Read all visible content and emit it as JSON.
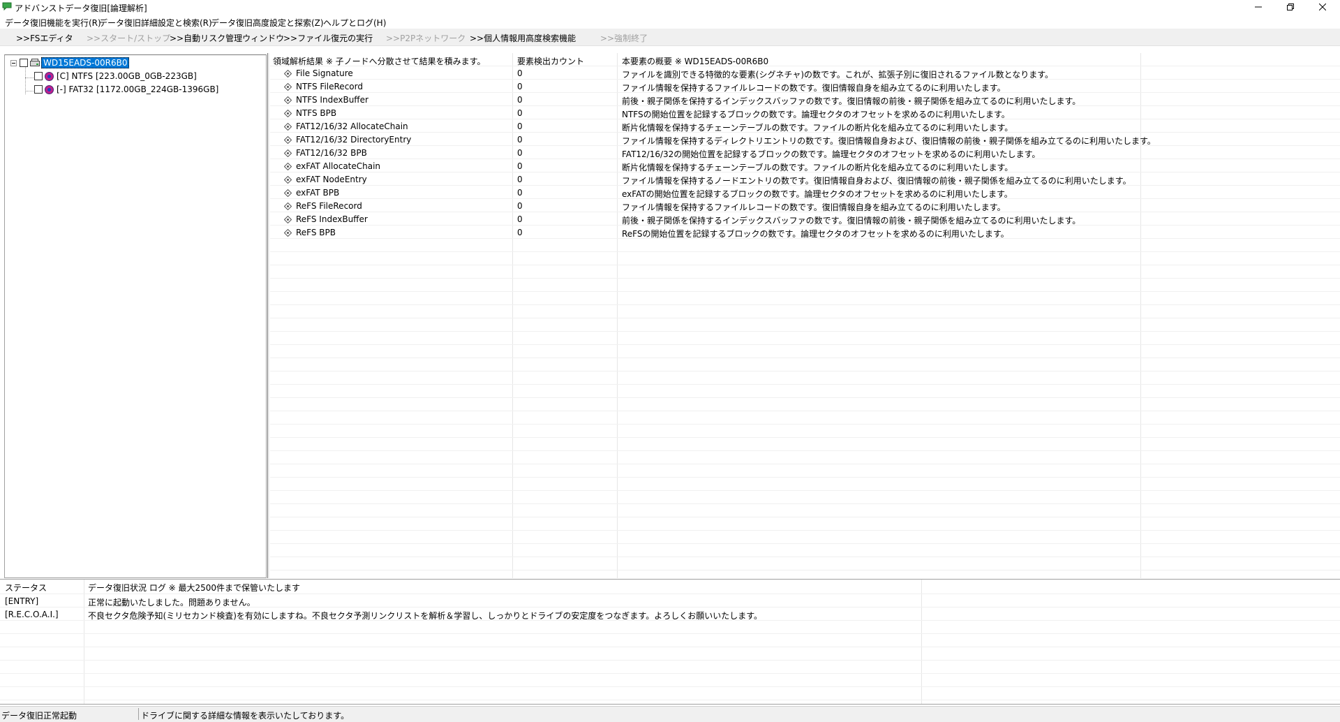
{
  "window": {
    "title": "アドバンストデータ復旧[論理解析]",
    "icon": "app-chat-icon",
    "accent": "#0078d7"
  },
  "menu": [
    {
      "label": "データ復旧機能を実行(R)"
    },
    {
      "label": "データ復旧詳細設定と検索(R)"
    },
    {
      "label": "データ復旧高度設定と探索(Z)"
    },
    {
      "label": "ヘルプとログ(H)"
    }
  ],
  "toolbar": [
    {
      "label": ">>FSエディタ",
      "enabled": true
    },
    {
      "label": ">>スタート/ストップ",
      "enabled": false
    },
    {
      "label": ">>自動リスク管理ウィンドウ",
      "enabled": true
    },
    {
      "label": ">>ファイル復元の実行",
      "enabled": true
    },
    {
      "label": ">>P2Pネットワーク",
      "enabled": false
    },
    {
      "label": ">>個人情報用高度検索機能",
      "enabled": true
    },
    {
      "label": ">>強制終了",
      "enabled": false
    }
  ],
  "tree": {
    "root": {
      "label": "WD15EADS-00R6B0",
      "selected": true
    },
    "children": [
      {
        "label": "[C] NTFS [223.00GB_0GB-223GB]"
      },
      {
        "label": "[-] FAT32 [1172.00GB_224GB-1396GB]"
      }
    ]
  },
  "list": {
    "headers": [
      "領域解析結果 ※ 子ノードへ分散させて結果を積みます。",
      "要素検出カウント",
      "本要素の概要 ※ WD15EADS-00R6B0"
    ],
    "rows": [
      {
        "name": "File Signature",
        "count": "0",
        "desc": "ファイルを識別できる特徴的な要素(シグネチャ)の数です。これが、拡張子別に復旧されるファイル数となります。"
      },
      {
        "name": "NTFS FileRecord",
        "count": "0",
        "desc": "ファイル情報を保持するファイルレコードの数です。復旧情報自身を組み立てるのに利用いたします。"
      },
      {
        "name": "NTFS IndexBuffer",
        "count": "0",
        "desc": "前後・親子関係を保持するインデックスバッファの数です。復旧情報の前後・親子関係を組み立てるのに利用いたします。"
      },
      {
        "name": "NTFS BPB",
        "count": "0",
        "desc": "NTFSの開始位置を記録するブロックの数です。論理セクタのオフセットを求めるのに利用いたします。"
      },
      {
        "name": "FAT12/16/32 AllocateChain",
        "count": "0",
        "desc": "断片化情報を保持するチェーンテーブルの数です。ファイルの断片化を組み立てるのに利用いたします。"
      },
      {
        "name": "FAT12/16/32 DirectoryEntry",
        "count": "0",
        "desc": "ファイル情報を保持するディレクトリエントリの数です。復旧情報自身および、復旧情報の前後・親子関係を組み立てるのに利用いたします。"
      },
      {
        "name": "FAT12/16/32 BPB",
        "count": "0",
        "desc": "FAT12/16/32の開始位置を記録するブロックの数です。論理セクタのオフセットを求めるのに利用いたします。"
      },
      {
        "name": "exFAT AllocateChain",
        "count": "0",
        "desc": "断片化情報を保持するチェーンテーブルの数です。ファイルの断片化を組み立てるのに利用いたします。"
      },
      {
        "name": "exFAT NodeEntry",
        "count": "0",
        "desc": "ファイル情報を保持するノードエントリの数です。復旧情報自身および、復旧情報の前後・親子関係を組み立てるのに利用いたします。"
      },
      {
        "name": "exFAT BPB",
        "count": "0",
        "desc": "exFATの開始位置を記録するブロックの数です。論理セクタのオフセットを求めるのに利用いたします。"
      },
      {
        "name": "ReFS FileRecord",
        "count": "0",
        "desc": "ファイル情報を保持するファイルレコードの数です。復旧情報自身を組み立てるのに利用いたします。"
      },
      {
        "name": "ReFS IndexBuffer",
        "count": "0",
        "desc": "前後・親子関係を保持するインデックスバッファの数です。復旧情報の前後・親子関係を組み立てるのに利用いたします。"
      },
      {
        "name": "ReFS BPB",
        "count": "0",
        "desc": "ReFSの開始位置を記録するブロックの数です。論理セクタのオフセットを求めるのに利用いたします。"
      }
    ]
  },
  "log": {
    "headers": [
      "ステータス",
      "データ復旧状況 ログ ※ 最大2500件まで保管いたします"
    ],
    "rows": [
      {
        "status": "[ENTRY]",
        "message": "正常に起動いたしました。問題ありません。"
      },
      {
        "status": "[R.E.C.O.A.I.]",
        "message": "不良セクタ危険予知(ミリセカンド検査)を有効にしますね。不良セクタ予測リンクリストを解析＆学習し、しっかりとドライブの安定度をつなぎます。よろしくお願いいたします。"
      }
    ]
  },
  "status": {
    "left": "データ復旧正常起動",
    "right": "ドライブに関する詳細な情報を表示いたしております。"
  }
}
